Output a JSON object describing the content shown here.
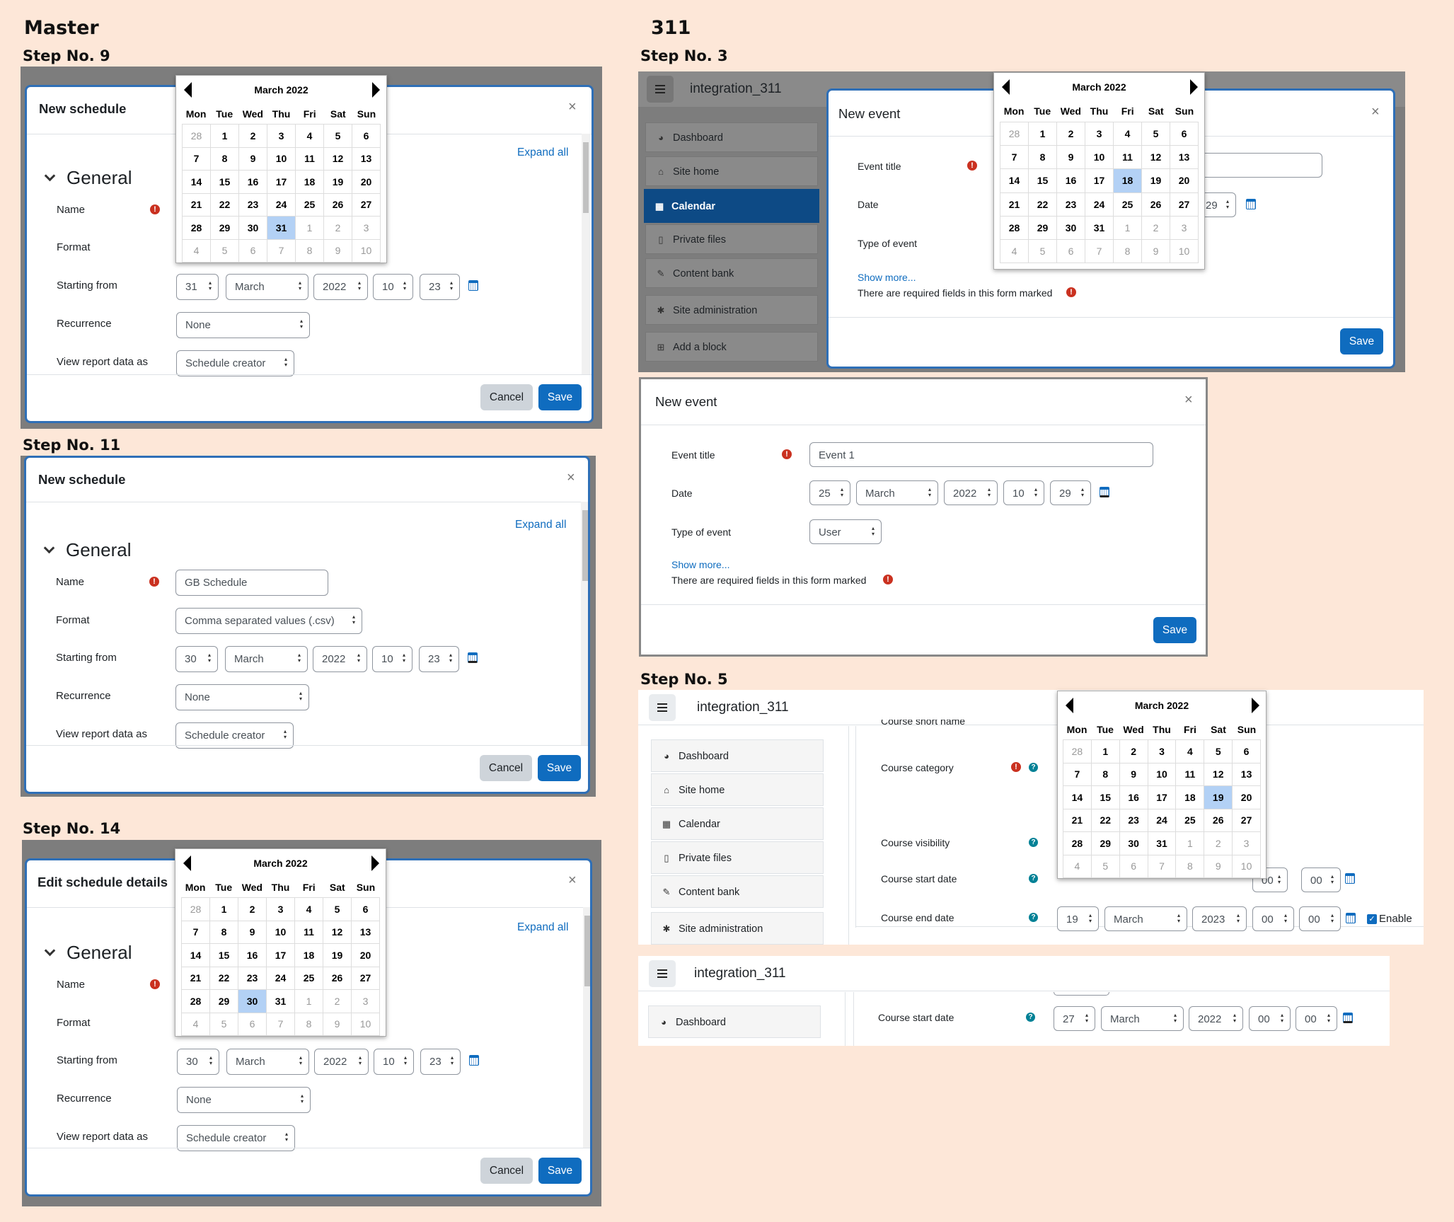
{
  "headers": {
    "master": "Master",
    "v311": "311"
  },
  "steps": {
    "s9": "Step No. 9",
    "s11": "Step No. 11",
    "s14": "Step No. 14",
    "s3": "Step No. 3",
    "s5": "Step No. 5"
  },
  "calendar": {
    "month": "March 2022",
    "dow": [
      "Mon",
      "Tue",
      "Wed",
      "Thu",
      "Fri",
      "Sat",
      "Sun"
    ]
  },
  "schedule_form": {
    "title_new": "New schedule",
    "title_edit": "Edit schedule details",
    "close": "×",
    "expand_all": "Expand all",
    "section": "General",
    "labels": {
      "name": "Name",
      "format": "Format",
      "starting_from": "Starting from",
      "recurrence": "Recurrence",
      "view_as": "View report data as"
    },
    "name_value": "GB Schedule",
    "format_value": "Comma separated values (.csv)",
    "month": "March",
    "year": "2022",
    "hour": "10",
    "minute": "23",
    "day_step9": "31",
    "day_step11": "30",
    "day_step14": "30",
    "recurrence": "None",
    "view_as": "Schedule creator",
    "cancel": "Cancel",
    "save": "Save",
    "selected_day_step9": "31",
    "selected_day_step14": "30"
  },
  "event_form": {
    "title": "New event",
    "close": "×",
    "event_title_label": "Event title",
    "date_label": "Date",
    "type_label": "Type of event",
    "show_more": "Show more...",
    "required_note": "There are required fields in this form marked",
    "event_title_value": "Event 1",
    "day": "25",
    "month": "March",
    "year": "2022",
    "hour": "10",
    "minute": "29",
    "type_value": "User",
    "save": "Save",
    "selected_day": "18"
  },
  "site": {
    "brand": "integration_311",
    "nav": [
      "Dashboard",
      "Site home",
      "Calendar",
      "Private files",
      "Content bank",
      "Site administration",
      "Add a block"
    ]
  },
  "course_form": {
    "short_name_cut": "Course short name",
    "category": "Course category",
    "visibility": "Course visibility",
    "start_date": "Course start date",
    "end_date": "Course end date",
    "start_minute": "00",
    "end_day": "19",
    "end_month": "March",
    "end_year": "2023",
    "end_hour": "00",
    "end_minute": "00",
    "enable": "Enable",
    "selected_day": "19",
    "bottom_start": {
      "day": "27",
      "month": "March",
      "year": "2022",
      "hour": "00",
      "minute": "00"
    }
  }
}
